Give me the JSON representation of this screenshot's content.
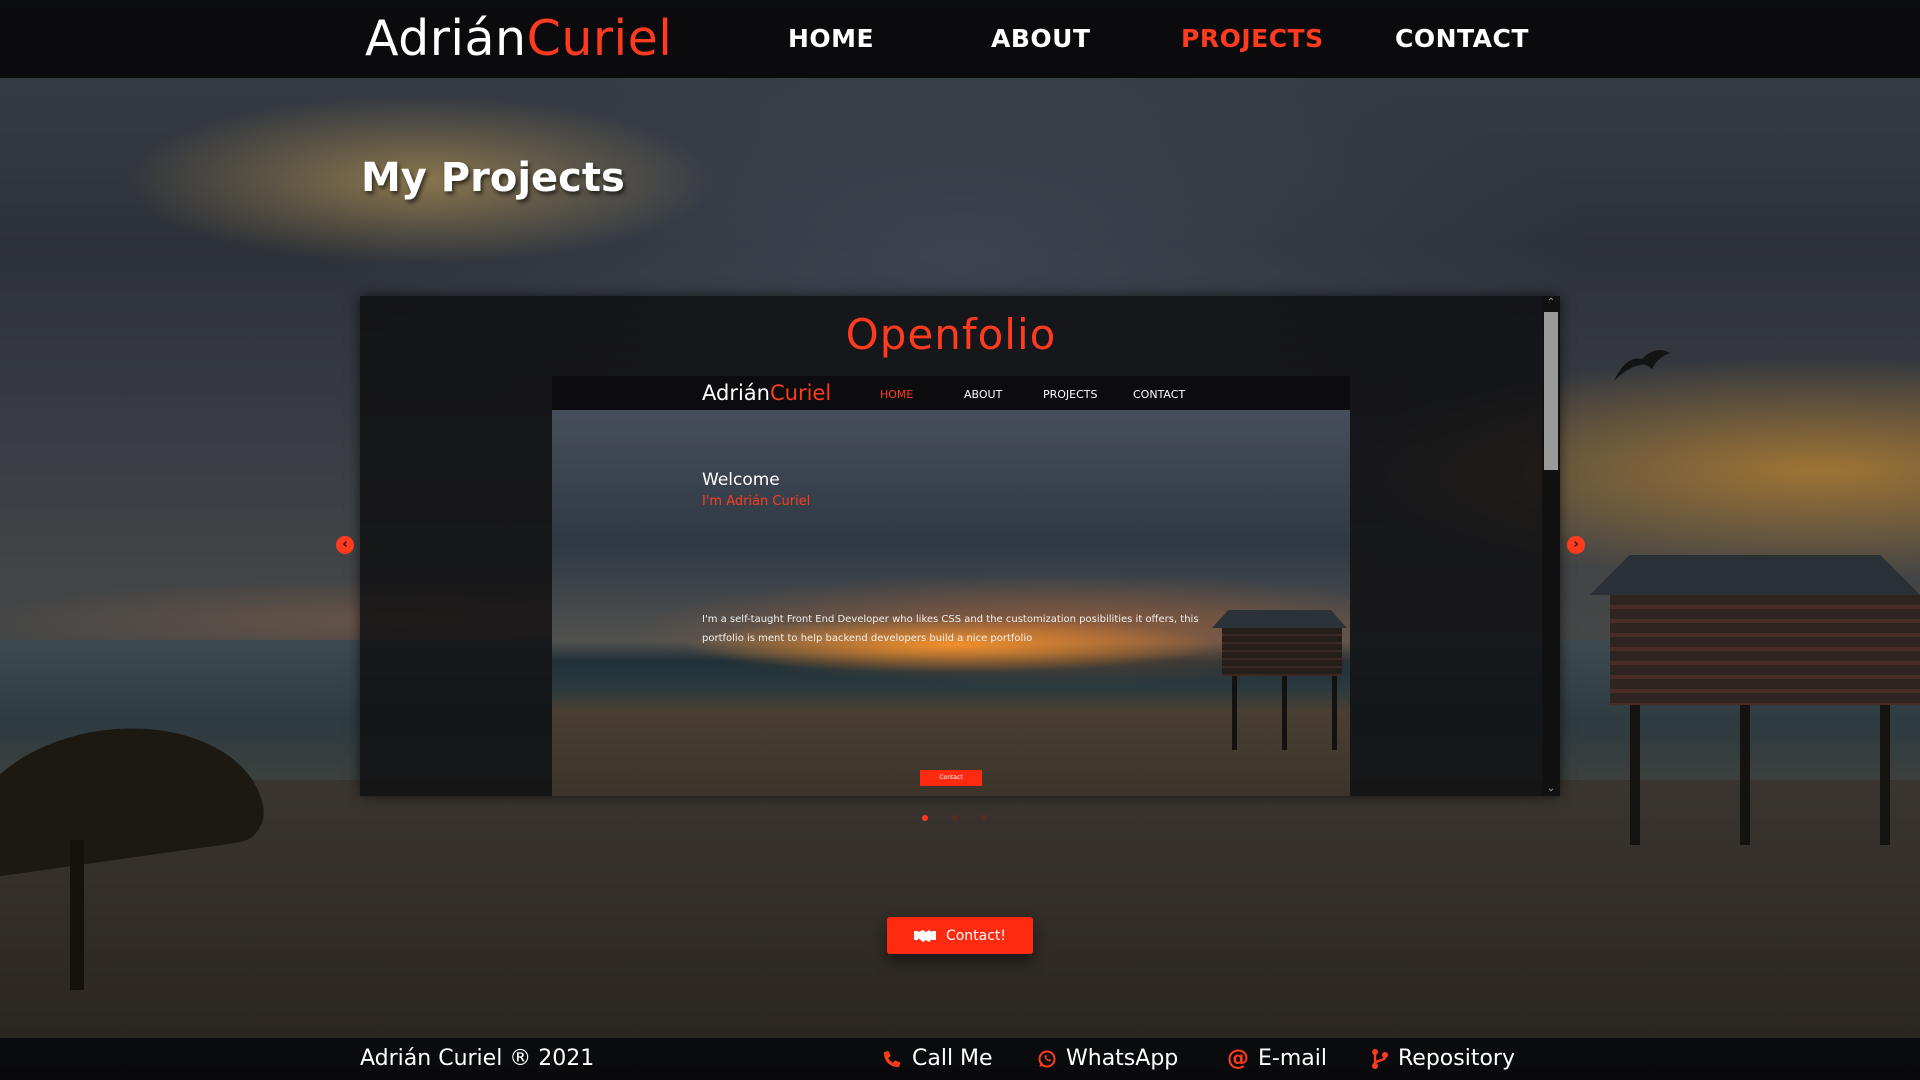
{
  "brand": {
    "first": "Adrián",
    "last": "Curiel"
  },
  "nav": {
    "items": [
      {
        "label": "HOME",
        "active": false
      },
      {
        "label": "ABOUT",
        "active": false
      },
      {
        "label": "PROJECTS",
        "active": true
      },
      {
        "label": "CONTACT",
        "active": false
      }
    ]
  },
  "page": {
    "title": "My Projects"
  },
  "carousel": {
    "project_title": "Openfolio",
    "slide_count": 3,
    "active_slide": 1,
    "preview": {
      "brand": {
        "first": "Adrián",
        "last": "Curiel"
      },
      "nav": [
        "HOME",
        "ABOUT",
        "PROJECTS",
        "CONTACT"
      ],
      "welcome": "Welcome",
      "name": "I'm Adrián Curiel",
      "description": "I'm a self-taught Front End Developer who likes CSS and the customization posibilities it offers, this portfolio is ment to help backend developers build a nice portfolio",
      "button": "Contact"
    }
  },
  "contact_button": {
    "label": "Contact!",
    "icon": "handshake-icon"
  },
  "footer": {
    "copyright": "Adrián Curiel  ® 2021",
    "links": [
      {
        "label": "Call Me",
        "icon": "phone-icon"
      },
      {
        "label": "WhatsApp",
        "icon": "whatsapp-icon"
      },
      {
        "label": "E-mail",
        "icon": "at-icon"
      },
      {
        "label": "Repository",
        "icon": "git-branch-icon"
      }
    ]
  },
  "colors": {
    "accent": "#ff3b1f",
    "bar": "#08090b",
    "button": "#ff2a10"
  }
}
